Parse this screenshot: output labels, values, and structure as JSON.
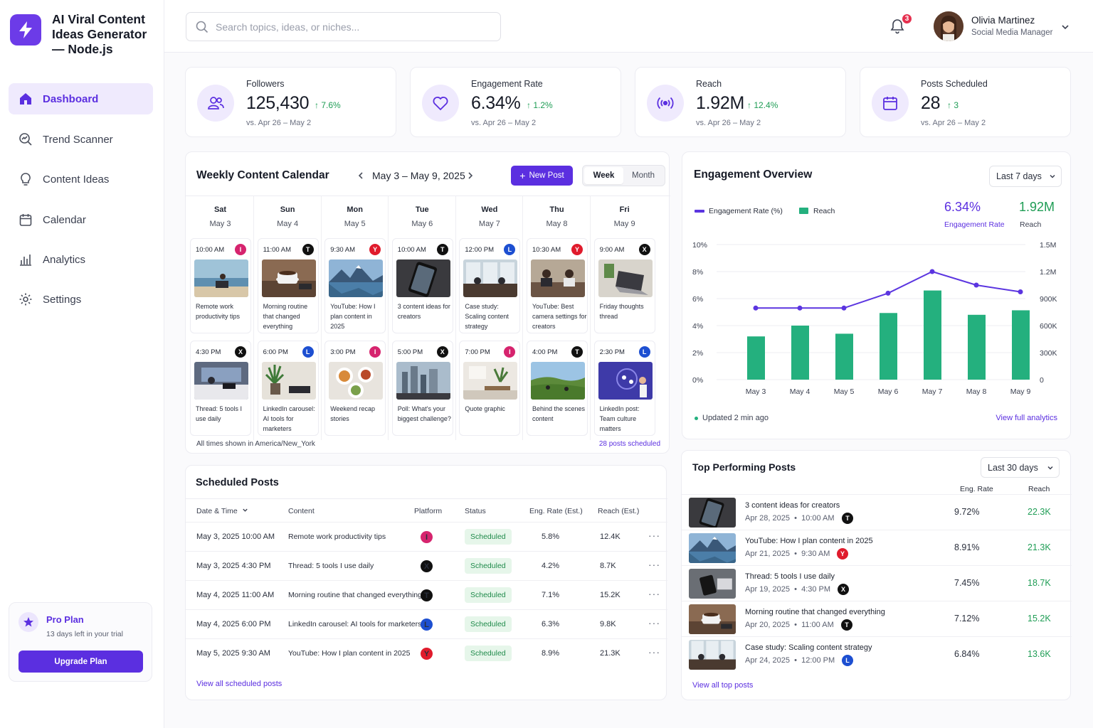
{
  "app": {
    "brand": "AI Viral Content Ideas Generator — Node.js"
  },
  "nav": [
    {
      "label": "Dashboard",
      "icon": "home-icon",
      "active": true
    },
    {
      "label": "Trend Scanner",
      "icon": "trend-scanner-icon"
    },
    {
      "label": "Content Ideas",
      "icon": "lightbulb-icon"
    },
    {
      "label": "Calendar",
      "icon": "calendar-icon"
    },
    {
      "label": "Analytics",
      "icon": "bar-chart-icon"
    },
    {
      "label": "Settings",
      "icon": "gear-icon"
    }
  ],
  "pro": {
    "title": "Pro Plan",
    "sub": "13 days left in your trial",
    "button": "Upgrade Plan"
  },
  "search": {
    "placeholder": "Search topics, ideas, or niches..."
  },
  "notifications": {
    "count": "3"
  },
  "user": {
    "name": "Olivia Martinez",
    "role": "Social Media Manager"
  },
  "stats": [
    {
      "label": "Followers",
      "value": "125,430",
      "delta": "7.6%",
      "sub": "vs. Apr 26 – May 2",
      "icon": "users-icon"
    },
    {
      "label": "Engagement Rate",
      "value": "6.34%",
      "delta": "1.2%",
      "sub": "vs. Apr 26 – May 2",
      "icon": "heart-icon"
    },
    {
      "label": "Reach",
      "value": "1.92M",
      "delta": "12.4%",
      "sub": "vs. Apr 26 – May 2",
      "icon": "broadcast-icon"
    },
    {
      "label": "Posts Scheduled",
      "value": "28",
      "delta": "3",
      "sub": "vs. Apr 26 – May 2",
      "icon": "calendar-icon"
    }
  ],
  "calendar": {
    "title": "Weekly Content Calendar",
    "range": "May 3 – May 9, 2025",
    "new_post": "New Post",
    "view_week": "Week",
    "view_month": "Month",
    "footer_tz": "All times shown in America/New_York",
    "footer_count": "28 posts scheduled",
    "days": [
      {
        "name": "Sat",
        "date": "May 3",
        "posts": [
          {
            "time": "10:00 AM",
            "pf": "I",
            "text": "Remote work productivity tips"
          },
          {
            "time": "4:30 PM",
            "pf": "X",
            "text": "Thread: 5 tools I use daily"
          }
        ]
      },
      {
        "name": "Sun",
        "date": "May 4",
        "posts": [
          {
            "time": "11:00 AM",
            "pf": "T",
            "text": "Morning routine that changed everything"
          },
          {
            "time": "6:00 PM",
            "pf": "L",
            "text": "LinkedIn carousel: AI tools for marketers"
          }
        ]
      },
      {
        "name": "Mon",
        "date": "May 5",
        "posts": [
          {
            "time": "9:30 AM",
            "pf": "Y",
            "text": "YouTube: How I plan content in 2025"
          },
          {
            "time": "3:00 PM",
            "pf": "I",
            "text": "Weekend recap stories"
          }
        ]
      },
      {
        "name": "Tue",
        "date": "May 6",
        "posts": [
          {
            "time": "10:00 AM",
            "pf": "T",
            "text": "3 content ideas for creators"
          },
          {
            "time": "5:00 PM",
            "pf": "X",
            "text": "Poll: What's your biggest challenge?"
          }
        ]
      },
      {
        "name": "Wed",
        "date": "May 7",
        "posts": [
          {
            "time": "12:00 PM",
            "pf": "L",
            "text": "Case study: Scaling content strategy"
          },
          {
            "time": "7:00 PM",
            "pf": "I",
            "text": "Quote graphic"
          }
        ]
      },
      {
        "name": "Thu",
        "date": "May 8",
        "posts": [
          {
            "time": "10:30 AM",
            "pf": "Y",
            "text": "YouTube: Best camera settings for creators"
          },
          {
            "time": "4:00 PM",
            "pf": "T",
            "text": "Behind the scenes content"
          }
        ]
      },
      {
        "name": "Fri",
        "date": "May 9",
        "posts": [
          {
            "time": "9:00 AM",
            "pf": "X",
            "text": "Friday thoughts thread"
          },
          {
            "time": "2:30 PM",
            "pf": "L",
            "text": "LinkedIn post: Team culture matters"
          }
        ]
      }
    ]
  },
  "platform_colors": {
    "I": "#d6246e",
    "X": "#111111",
    "T": "#111111",
    "L": "#1d4fd1",
    "Y": "#e01b2c"
  },
  "scheduled": {
    "title": "Scheduled Posts",
    "headers": [
      "Date & Time",
      "Content",
      "Platform",
      "Status",
      "Eng. Rate (Est.)",
      "Reach (Est.)"
    ],
    "rows": [
      {
        "date": "May 3, 2025 10:00 AM",
        "content": "Remote work productivity tips",
        "pf": "I",
        "status": "Scheduled",
        "rate": "5.8%",
        "reach": "12.4K"
      },
      {
        "date": "May 3, 2025 4:30 PM",
        "content": "Thread: 5 tools I use daily",
        "pf": "X",
        "status": "Scheduled",
        "rate": "4.2%",
        "reach": "8.7K"
      },
      {
        "date": "May 4, 2025 11:00 AM",
        "content": "Morning routine that changed everything",
        "pf": "T",
        "status": "Scheduled",
        "rate": "7.1%",
        "reach": "15.2K"
      },
      {
        "date": "May 4, 2025 6:00 PM",
        "content": "LinkedIn carousel: AI tools for marketers",
        "pf": "L",
        "status": "Scheduled",
        "rate": "6.3%",
        "reach": "9.8K"
      },
      {
        "date": "May 5, 2025 9:30 AM",
        "content": "YouTube: How I plan content in 2025",
        "pf": "Y",
        "status": "Scheduled",
        "rate": "8.9%",
        "reach": "21.3K"
      }
    ],
    "view_all": "View all scheduled posts"
  },
  "engagement": {
    "title": "Engagement Overview",
    "range": "Last 7 days",
    "legend_rate": "Engagement Rate (%)",
    "legend_reach": "Reach",
    "big_rate": "6.34%",
    "big_rate_label": "Engagement Rate",
    "big_reach": "1.92M",
    "big_reach_label": "Reach",
    "updated": "Updated 2 min ago",
    "view_full": "View full analytics"
  },
  "chart_data": {
    "type": "bar",
    "categories": [
      "May 3",
      "May 4",
      "May 5",
      "May 6",
      "May 7",
      "May 8",
      "May 9"
    ],
    "series": [
      {
        "name": "Reach",
        "type": "bar",
        "axis": "right",
        "values": [
          480000,
          600000,
          510000,
          740000,
          990000,
          720000,
          770000
        ]
      },
      {
        "name": "Engagement Rate (%)",
        "type": "line",
        "axis": "left",
        "values": [
          5.3,
          5.3,
          5.3,
          6.4,
          8.0,
          7.0,
          6.5
        ]
      }
    ],
    "y_left_ticks": [
      "0%",
      "2%",
      "4%",
      "6%",
      "8%",
      "10%"
    ],
    "y_right_ticks": [
      "0",
      "300K",
      "600K",
      "900K",
      "1.2M",
      "1.5M"
    ],
    "ylim_left": [
      0,
      10
    ],
    "ylim_right": [
      0,
      1500000
    ],
    "colors": {
      "bar": "#24b07e",
      "line": "#5b35e0"
    },
    "grid": true,
    "legend": "top-left"
  },
  "top_posts": {
    "title": "Top Performing Posts",
    "range": "Last 30 days",
    "col_rate": "Eng. Rate",
    "col_reach": "Reach",
    "rows": [
      {
        "title": "3 content ideas for creators",
        "date": "Apr 28, 2025",
        "time": "10:00 AM",
        "pf": "T",
        "rate": "9.72%",
        "reach": "22.3K"
      },
      {
        "title": "YouTube: How I plan content in 2025",
        "date": "Apr 21, 2025",
        "time": "9:30 AM",
        "pf": "Y",
        "rate": "8.91%",
        "reach": "21.3K"
      },
      {
        "title": "Thread: 5 tools I use daily",
        "date": "Apr 19, 2025",
        "time": "4:30 PM",
        "pf": "X",
        "rate": "7.45%",
        "reach": "18.7K"
      },
      {
        "title": "Morning routine that changed everything",
        "date": "Apr 20, 2025",
        "time": "11:00 AM",
        "pf": "T",
        "rate": "7.12%",
        "reach": "15.2K"
      },
      {
        "title": "Case study: Scaling content strategy",
        "date": "Apr 24, 2025",
        "time": "12:00 PM",
        "pf": "L",
        "rate": "6.84%",
        "reach": "13.6K"
      }
    ],
    "view_all": "View all top posts"
  }
}
